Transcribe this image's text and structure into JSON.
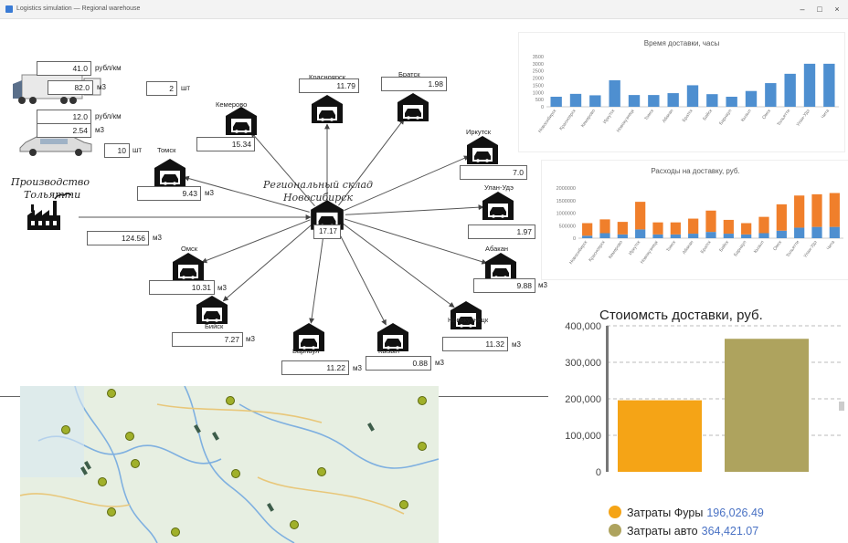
{
  "window": {
    "title": "Logistics simulation — Regional warehouse"
  },
  "inputs": {
    "truck_rate": "41.0",
    "truck_rate_unit": "рубл/км",
    "truck_volume": "82.0",
    "truck_volume_unit": "м3",
    "truck_count": "2",
    "truck_count_unit": "шт",
    "car_rate": "12.0",
    "car_rate_unit": "рубл/км",
    "car_volume": "2.54",
    "car_volume_unit": "м3",
    "car_count": "10",
    "car_count_unit": "шт"
  },
  "production": {
    "label_line1": "Производство",
    "label_line2": "Тольятти",
    "value": "124.56",
    "unit": "м3"
  },
  "hub": {
    "label_line1": "Региональный склад",
    "label_line2": "Новосибирск",
    "value": "17.17"
  },
  "warehouses": [
    {
      "id": "tomsk",
      "name": "Томск",
      "value": "9.43",
      "unit": "м3"
    },
    {
      "id": "kemerovo",
      "name": "Кемерово",
      "value": "15.34",
      "unit": ""
    },
    {
      "id": "krasnoyarsk",
      "name": "Красноярск",
      "value": "11.79",
      "unit": ""
    },
    {
      "id": "bratsk",
      "name": "Братск",
      "value": "1.98",
      "unit": ""
    },
    {
      "id": "irkutsk",
      "name": "Иркутск",
      "value": "7.0",
      "unit": ""
    },
    {
      "id": "ulan-ude",
      "name": "Улан-Удэ",
      "value": "1.97",
      "unit": ""
    },
    {
      "id": "abakan",
      "name": "Абакан",
      "value": "9.88",
      "unit": "м3"
    },
    {
      "id": "novokuznetsk",
      "name": "Новокузнецк",
      "value": "11.32",
      "unit": "м3"
    },
    {
      "id": "kyzyl",
      "name": "Кызыл",
      "value": "0.88",
      "unit": "м3"
    },
    {
      "id": "barnaul",
      "name": "Барнаул",
      "value": "11.22",
      "unit": "м3"
    },
    {
      "id": "biysk",
      "name": "Бийск",
      "value": "7.27",
      "unit": "м3"
    },
    {
      "id": "omsk",
      "name": "Омск",
      "value": "10.31",
      "unit": "м3"
    }
  ],
  "chart_data": [
    {
      "type": "bar",
      "title": "Время доставки, часы",
      "categories": [
        "Новосибирск",
        "Красноярск",
        "Кемерово",
        "Иркутск",
        "Новокузнецк",
        "Томск",
        "Абакан",
        "Братск",
        "Бийск",
        "Барнаул",
        "Кызыл",
        "Омск",
        "Тольятти",
        "Улан-Удэ",
        "Чита"
      ],
      "ylim": [
        0,
        3500
      ],
      "yticks": [
        "0",
        "500",
        "1000",
        "1500",
        "2000",
        "2500",
        "3000",
        "3500"
      ],
      "series": [
        {
          "values": [
            700,
            900,
            800,
            1850,
            820,
            820,
            950,
            1500,
            880,
            700,
            1100,
            1650,
            2300,
            3000,
            3000
          ]
        }
      ],
      "color": "#4e8fd0",
      "grid": false
    },
    {
      "type": "bar",
      "stacked": true,
      "title": "Расходы на доставку, руб.",
      "categories": [
        "Новосибирск",
        "Красноярск",
        "Кемерово",
        "Иркутск",
        "Новокузнецк",
        "Томск",
        "Абакан",
        "Братск",
        "Бийск",
        "Барнаул",
        "Кызыл",
        "Омск",
        "Тольятти",
        "Улан-Удэ",
        "Чита"
      ],
      "ylim": [
        0,
        2000000
      ],
      "yticks": [
        "0",
        "500000",
        "1000000",
        "1500000",
        "2000000"
      ],
      "series": [
        {
          "values": [
            100000,
            200000,
            150000,
            350000,
            150000,
            150000,
            180000,
            250000,
            180000,
            150000,
            200000,
            300000,
            420000,
            450000,
            450000
          ],
          "color": "#4e8fd0"
        },
        {
          "values": [
            500000,
            550000,
            500000,
            1100000,
            480000,
            480000,
            600000,
            850000,
            550000,
            450000,
            650000,
            1050000,
            1280000,
            1300000,
            1350000
          ],
          "color": "#f07f2b"
        }
      ],
      "grid": false
    },
    {
      "type": "bar",
      "title": "Стоиомсть доставки, руб.",
      "categories": [
        "Затраты Фуры",
        "Затраты авто"
      ],
      "values": [
        196026.49,
        364421.07
      ],
      "value_labels": [
        "196,026.49",
        "364,421.07"
      ],
      "ylim": [
        0,
        400000
      ],
      "yticks": [
        "0",
        "100,000",
        "200,000",
        "300,000",
        "400,000"
      ],
      "colors": [
        "#f5a416",
        "#aea35e"
      ],
      "legend": "bottom",
      "grid": true
    }
  ]
}
